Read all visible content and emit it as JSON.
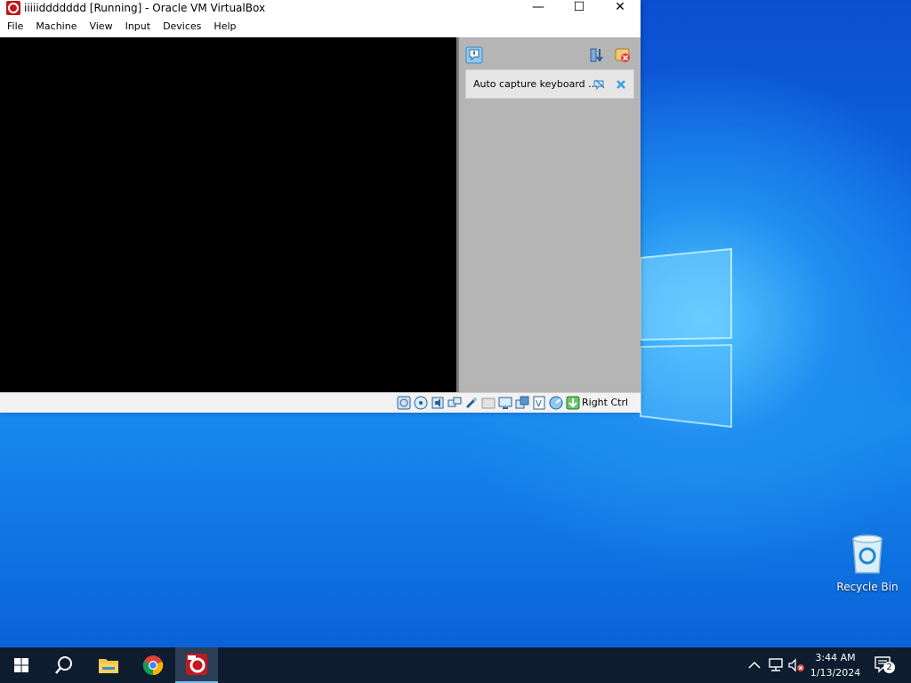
{
  "window": {
    "title": "iiiiiddddddd [Running] - Oracle VM VirtualBox",
    "controls": {
      "minimize": "—",
      "maximize": "☐",
      "close": "✕"
    }
  },
  "menu": [
    "File",
    "Machine",
    "View",
    "Input",
    "Devices",
    "Help"
  ],
  "notification": {
    "text": "Auto capture keyboard ..."
  },
  "statusbar": {
    "host_key": "Right Ctrl"
  },
  "desktop": {
    "recycle_bin_label": "Recycle Bin"
  },
  "taskbar": {
    "time": "3:44 AM",
    "date": "1/13/2024",
    "notification_count": "2"
  },
  "colors": {
    "accent": "#0078d7",
    "taskbar": "#0d1c2e",
    "vm_screen": "#000000",
    "panel": "#b5b5b5"
  }
}
